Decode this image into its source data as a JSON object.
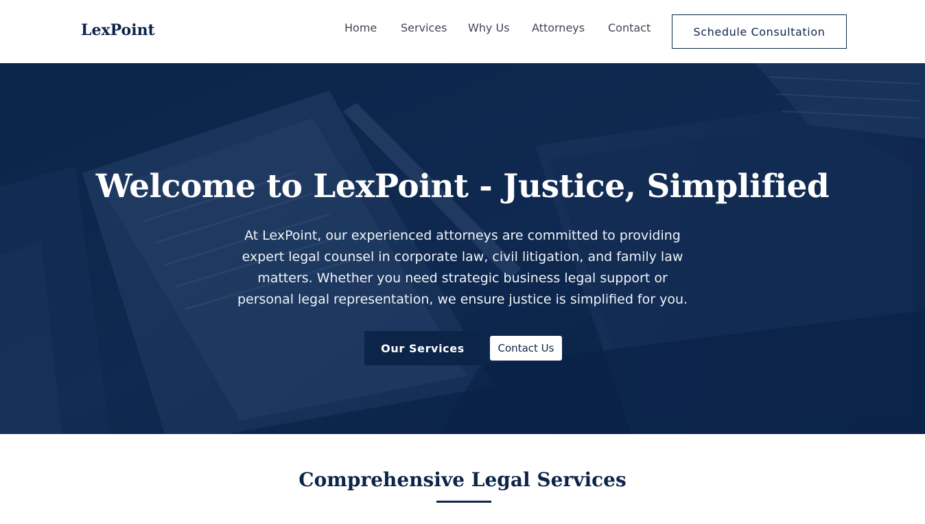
{
  "header": {
    "logo": "LexPoint",
    "nav": [
      {
        "label": "Home"
      },
      {
        "label": "Services"
      },
      {
        "label": "Why Us"
      },
      {
        "label": "Attorneys"
      },
      {
        "label": "Contact"
      }
    ],
    "cta_label": "Schedule Consultation"
  },
  "hero": {
    "title": "Welcome to LexPoint - Justice, Simplified",
    "description": "At LexPoint, our experienced attorneys are committed to providing expert legal counsel in corporate law, civil litigation, and family law matters. Whether you need strategic business legal support or personal legal representation, we ensure justice is simplified for you.",
    "primary_button": "Our Services",
    "secondary_button": "Contact Us"
  },
  "services": {
    "title": "Comprehensive Legal Services"
  },
  "colors": {
    "brand_navy": "#0d2449",
    "nav_text": "#3f4654",
    "white": "#ffffff"
  },
  "icons": {
    "logo": "lexpoint-wordmark"
  }
}
